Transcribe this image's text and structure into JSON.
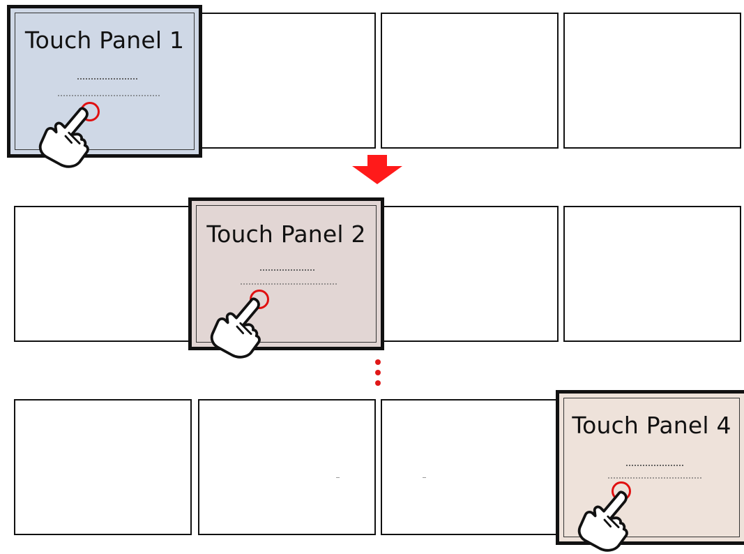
{
  "panels": [
    {
      "title": "Touch Panel 1",
      "fill": "#cfd8e6"
    },
    {
      "title": "Touch Panel 2",
      "fill": "#e2d6d4"
    },
    {
      "title": "Touch Panel 4",
      "fill": "#eee2da"
    }
  ],
  "colors": {
    "arrow": "#ff1a1a",
    "dots": "#e01818",
    "touch_ring": "#e01010",
    "border": "#111111"
  },
  "icons": [
    "hand-pointer-icon",
    "arrow-down-icon"
  ]
}
